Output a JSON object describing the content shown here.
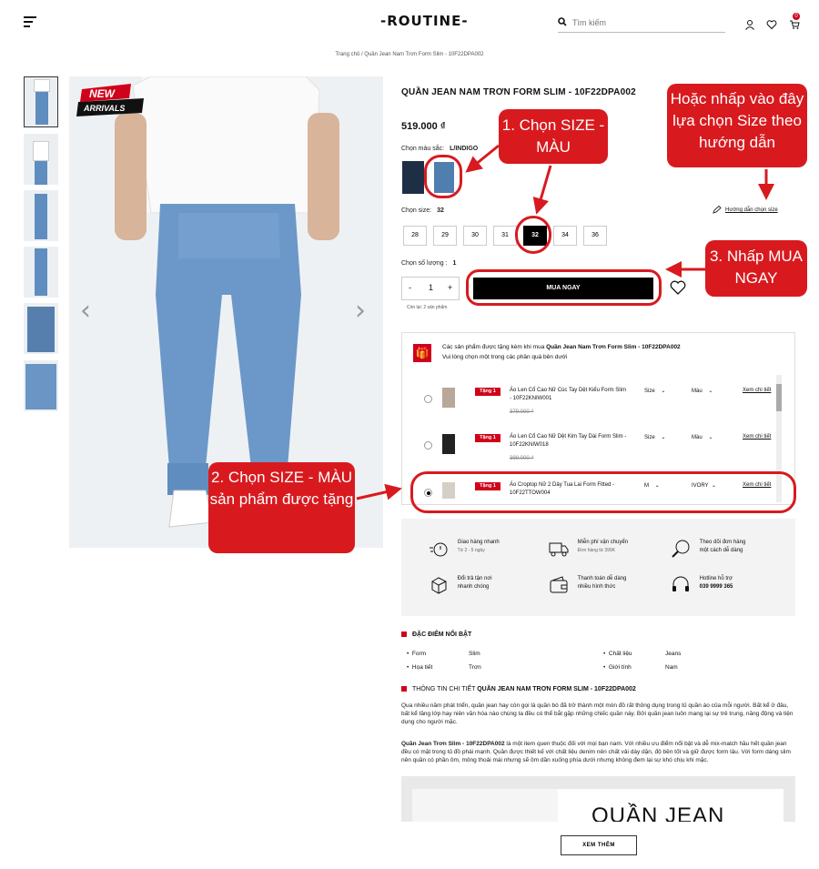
{
  "header": {
    "logo": "-ROUTINE-",
    "search_placeholder": "Tìm kiếm",
    "cart_count": "0"
  },
  "breadcrumb": "Trang chủ / Quần Jean Nam Trơn Form Slim - 10F22DPA002",
  "gallery": {
    "badge_top": "NEW",
    "badge_bottom": "ARRIVALS"
  },
  "product": {
    "title": "QUẦN JEAN NAM TRƠN FORM SLIM - 10F22DPA002",
    "price": "519.000 ₫",
    "color_label": "Chọn màu sắc:",
    "color_value": "L/INDIGO",
    "size_label": "Chọn size:",
    "size_value": "32",
    "sizes": [
      "28",
      "29",
      "30",
      "31",
      "32",
      "34",
      "36"
    ],
    "size_guide": "Hướng dẫn chọn size",
    "qty_label": "Chọn số lượng :",
    "qty_value": "1",
    "qty_minus": "-",
    "qty_plus": "+",
    "buy_label": "MUA NGAY",
    "stock": "Còn lại: 2 sản phẩm"
  },
  "gift": {
    "head_prefix": "Các sản phẩm được tặng kèm khi mua",
    "head_product": "Quần Jean Nam Trơn Form Slim - 10F22DPA002",
    "head_line2": "Vui lòng chọn một trong các phần quà bên dưới",
    "items": [
      {
        "tag": "Tặng 1",
        "name": "Áo Len Cổ Cao Nữ Cúc Tay Dệt Kiểu Form Slim - 10F22KNIW001",
        "price": "379.000 ₫",
        "size": "Size",
        "color": "Màu",
        "detail": "Xem chi tiết"
      },
      {
        "tag": "Tặng 1",
        "name": "Áo Len Cổ Cao Nữ Dệt Kim Tay Dài Form Slim - 10F22KNIW018",
        "price": "399.000 ₫",
        "size": "Size",
        "color": "Màu",
        "detail": "Xem chi tiết"
      },
      {
        "tag": "Tặng 1",
        "name": "Áo Croptop Nữ 2 Dây Tua Lai Form Fitted - 10F22TTOW004",
        "price": "",
        "size": "M",
        "color": "IVORY",
        "detail": "Xem chi tiết"
      }
    ]
  },
  "services": [
    {
      "title": "Giao hàng nhanh",
      "sub": "Từ 2 - 5 ngày"
    },
    {
      "title": "Miễn phí vận chuyển",
      "sub": "Đơn hàng từ 399K"
    },
    {
      "title": "Theo dõi đơn hàng",
      "sub": "một cách dễ dàng"
    },
    {
      "title": "Đổi trả tận nơi",
      "sub": "nhanh chóng"
    },
    {
      "title": "Thanh toán dễ dàng",
      "sub": "nhiều hình thức"
    },
    {
      "title": "Hotline hỗ trợ",
      "sub": "039 9999 365"
    }
  ],
  "features": {
    "heading": "ĐẶC ĐIỂM NỔI BẬT",
    "rows": [
      {
        "k1": "Form",
        "v1": "Slim",
        "k2": "Chất liệu",
        "v2": "Jeans"
      },
      {
        "k1": "Họa tiết",
        "v1": "Trơn",
        "k2": "Giới tính",
        "v2": "Nam"
      }
    ]
  },
  "details": {
    "heading_prefix": "THÔNG TIN CHI TIẾT",
    "heading_product": "QUẦN JEAN NAM TRƠN FORM SLIM - 10F22DPA002",
    "para1": "Qua nhiều năm phát triển, quần jean hay còn gọi là quần bò đã trở thành một món đồ rất thông dụng trong tủ quần áo của mỗi người. Bất kể ở đâu, bất kể tầng lớp hay niên văn hóa nào chúng ta đều có thể bắt gặp những chiếc quần này. Bởi quần jean luôn mang lại sự trẻ trung, năng động và tiện dụng cho người mặc.",
    "para2_bold": "Quần Jean Trơn Slim - 10F22DPA002",
    "para2": " là một item quen thuộc đối với mọi bạn nam. Với nhiều ưu điểm nổi bật và dễ mix-match hầu hết quần jean đều có mặt trong tủ đồ phái mạnh. Quần được thiết kế với chất liệu denim nên chất vải dày dặn, độ bền tốt và giữ được form lâu. Với form dáng slim nên quần có phần ôm, mông thoải mái nhưng sẽ ôm dần xuống phía dưới nhưng không đem lại sự khó chịu khi mặc.",
    "banner_text": "QUẦN JEAN",
    "more_label": "XEM THÊM"
  },
  "callouts": {
    "c1": "1. Chọn SIZE - MÀU",
    "c2": "2. Chọn SIZE - MÀU sản phẩm được tặng",
    "c3": "3. Nhấp MUA NGAY",
    "c4": "Hoặc nhấp vào đây lựa chọn Size theo hướng dẫn"
  },
  "colors": {
    "accent": "#d81a1f",
    "black": "#000000",
    "denim": "#5f8dbf"
  }
}
